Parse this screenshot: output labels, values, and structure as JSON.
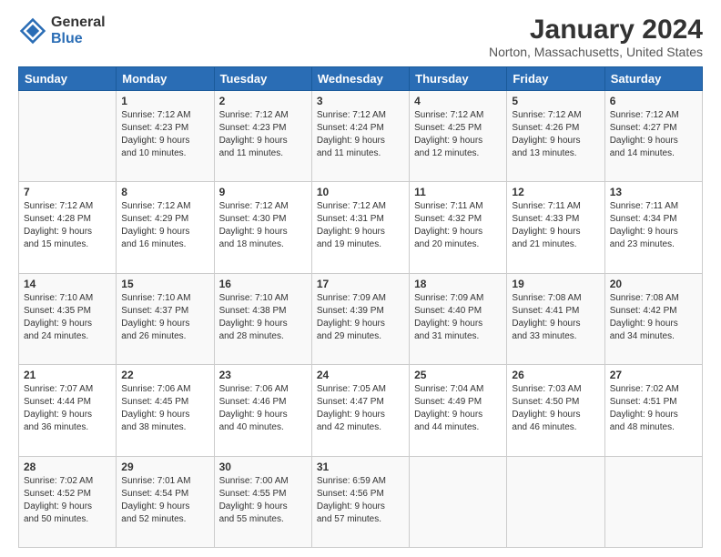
{
  "header": {
    "logo_general": "General",
    "logo_blue": "Blue",
    "title": "January 2024",
    "location": "Norton, Massachusetts, United States"
  },
  "weekdays": [
    "Sunday",
    "Monday",
    "Tuesday",
    "Wednesday",
    "Thursday",
    "Friday",
    "Saturday"
  ],
  "weeks": [
    [
      {
        "day": "",
        "info": ""
      },
      {
        "day": "1",
        "info": "Sunrise: 7:12 AM\nSunset: 4:23 PM\nDaylight: 9 hours\nand 10 minutes."
      },
      {
        "day": "2",
        "info": "Sunrise: 7:12 AM\nSunset: 4:23 PM\nDaylight: 9 hours\nand 11 minutes."
      },
      {
        "day": "3",
        "info": "Sunrise: 7:12 AM\nSunset: 4:24 PM\nDaylight: 9 hours\nand 11 minutes."
      },
      {
        "day": "4",
        "info": "Sunrise: 7:12 AM\nSunset: 4:25 PM\nDaylight: 9 hours\nand 12 minutes."
      },
      {
        "day": "5",
        "info": "Sunrise: 7:12 AM\nSunset: 4:26 PM\nDaylight: 9 hours\nand 13 minutes."
      },
      {
        "day": "6",
        "info": "Sunrise: 7:12 AM\nSunset: 4:27 PM\nDaylight: 9 hours\nand 14 minutes."
      }
    ],
    [
      {
        "day": "7",
        "info": "Sunrise: 7:12 AM\nSunset: 4:28 PM\nDaylight: 9 hours\nand 15 minutes."
      },
      {
        "day": "8",
        "info": "Sunrise: 7:12 AM\nSunset: 4:29 PM\nDaylight: 9 hours\nand 16 minutes."
      },
      {
        "day": "9",
        "info": "Sunrise: 7:12 AM\nSunset: 4:30 PM\nDaylight: 9 hours\nand 18 minutes."
      },
      {
        "day": "10",
        "info": "Sunrise: 7:12 AM\nSunset: 4:31 PM\nDaylight: 9 hours\nand 19 minutes."
      },
      {
        "day": "11",
        "info": "Sunrise: 7:11 AM\nSunset: 4:32 PM\nDaylight: 9 hours\nand 20 minutes."
      },
      {
        "day": "12",
        "info": "Sunrise: 7:11 AM\nSunset: 4:33 PM\nDaylight: 9 hours\nand 21 minutes."
      },
      {
        "day": "13",
        "info": "Sunrise: 7:11 AM\nSunset: 4:34 PM\nDaylight: 9 hours\nand 23 minutes."
      }
    ],
    [
      {
        "day": "14",
        "info": "Sunrise: 7:10 AM\nSunset: 4:35 PM\nDaylight: 9 hours\nand 24 minutes."
      },
      {
        "day": "15",
        "info": "Sunrise: 7:10 AM\nSunset: 4:37 PM\nDaylight: 9 hours\nand 26 minutes."
      },
      {
        "day": "16",
        "info": "Sunrise: 7:10 AM\nSunset: 4:38 PM\nDaylight: 9 hours\nand 28 minutes."
      },
      {
        "day": "17",
        "info": "Sunrise: 7:09 AM\nSunset: 4:39 PM\nDaylight: 9 hours\nand 29 minutes."
      },
      {
        "day": "18",
        "info": "Sunrise: 7:09 AM\nSunset: 4:40 PM\nDaylight: 9 hours\nand 31 minutes."
      },
      {
        "day": "19",
        "info": "Sunrise: 7:08 AM\nSunset: 4:41 PM\nDaylight: 9 hours\nand 33 minutes."
      },
      {
        "day": "20",
        "info": "Sunrise: 7:08 AM\nSunset: 4:42 PM\nDaylight: 9 hours\nand 34 minutes."
      }
    ],
    [
      {
        "day": "21",
        "info": "Sunrise: 7:07 AM\nSunset: 4:44 PM\nDaylight: 9 hours\nand 36 minutes."
      },
      {
        "day": "22",
        "info": "Sunrise: 7:06 AM\nSunset: 4:45 PM\nDaylight: 9 hours\nand 38 minutes."
      },
      {
        "day": "23",
        "info": "Sunrise: 7:06 AM\nSunset: 4:46 PM\nDaylight: 9 hours\nand 40 minutes."
      },
      {
        "day": "24",
        "info": "Sunrise: 7:05 AM\nSunset: 4:47 PM\nDaylight: 9 hours\nand 42 minutes."
      },
      {
        "day": "25",
        "info": "Sunrise: 7:04 AM\nSunset: 4:49 PM\nDaylight: 9 hours\nand 44 minutes."
      },
      {
        "day": "26",
        "info": "Sunrise: 7:03 AM\nSunset: 4:50 PM\nDaylight: 9 hours\nand 46 minutes."
      },
      {
        "day": "27",
        "info": "Sunrise: 7:02 AM\nSunset: 4:51 PM\nDaylight: 9 hours\nand 48 minutes."
      }
    ],
    [
      {
        "day": "28",
        "info": "Sunrise: 7:02 AM\nSunset: 4:52 PM\nDaylight: 9 hours\nand 50 minutes."
      },
      {
        "day": "29",
        "info": "Sunrise: 7:01 AM\nSunset: 4:54 PM\nDaylight: 9 hours\nand 52 minutes."
      },
      {
        "day": "30",
        "info": "Sunrise: 7:00 AM\nSunset: 4:55 PM\nDaylight: 9 hours\nand 55 minutes."
      },
      {
        "day": "31",
        "info": "Sunrise: 6:59 AM\nSunset: 4:56 PM\nDaylight: 9 hours\nand 57 minutes."
      },
      {
        "day": "",
        "info": ""
      },
      {
        "day": "",
        "info": ""
      },
      {
        "day": "",
        "info": ""
      }
    ]
  ]
}
